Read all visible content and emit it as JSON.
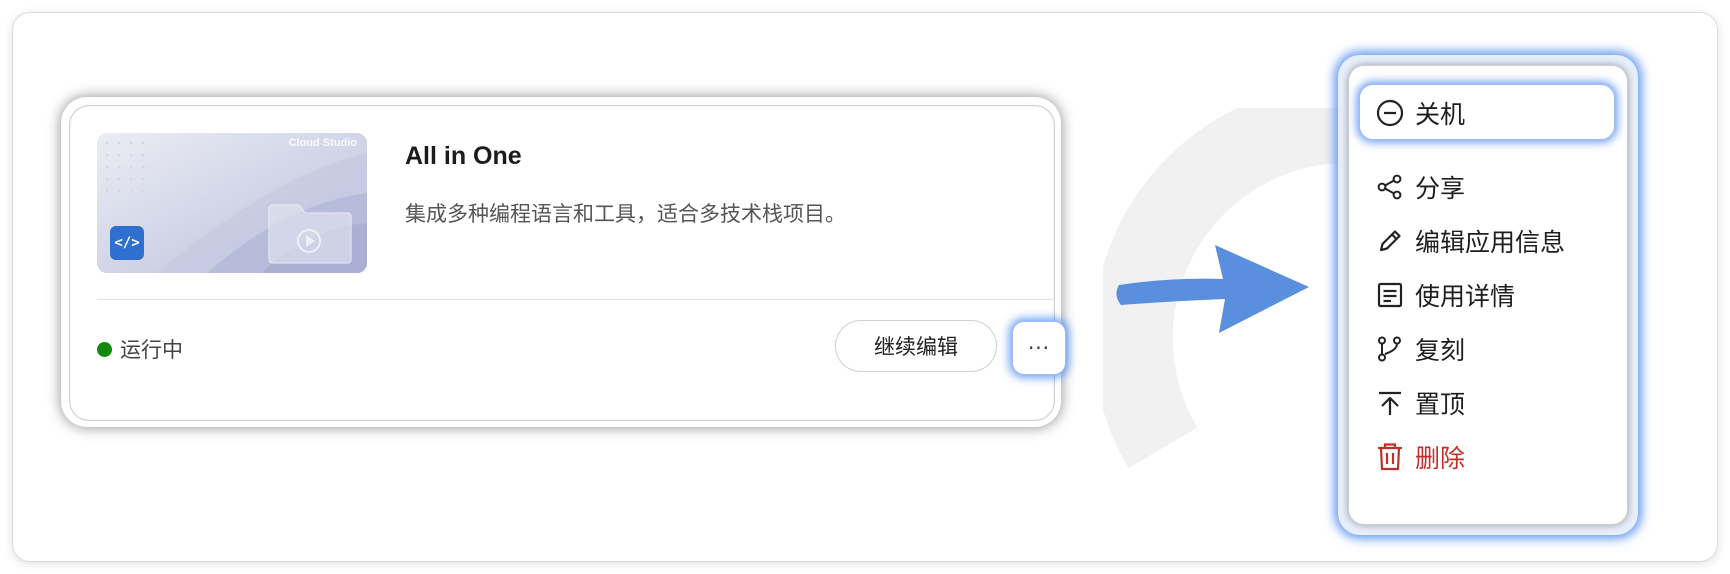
{
  "card": {
    "thumbnail_brand": "Cloud Studio",
    "code_badge": "</>",
    "title": "All in One",
    "description": "集成多种编程语言和工具，适合多技术栈项目。",
    "status": "运行中",
    "status_color": "#138a0c",
    "continue_button": "继续编辑",
    "more_button": "···"
  },
  "menu": {
    "items": [
      {
        "label": "关机",
        "icon": "minus-circle-icon"
      },
      {
        "label": "分享",
        "icon": "share-icon"
      },
      {
        "label": "编辑应用信息",
        "icon": "pencil-icon"
      },
      {
        "label": "使用详情",
        "icon": "document-icon"
      },
      {
        "label": "复刻",
        "icon": "fork-icon"
      },
      {
        "label": "置顶",
        "icon": "pin-top-icon"
      },
      {
        "label": "删除",
        "icon": "trash-icon",
        "color": "#c0302a"
      }
    ]
  },
  "colors": {
    "accent_glow": "#4d8af0",
    "arrow": "#5a8fe0",
    "danger": "#c0302a"
  }
}
